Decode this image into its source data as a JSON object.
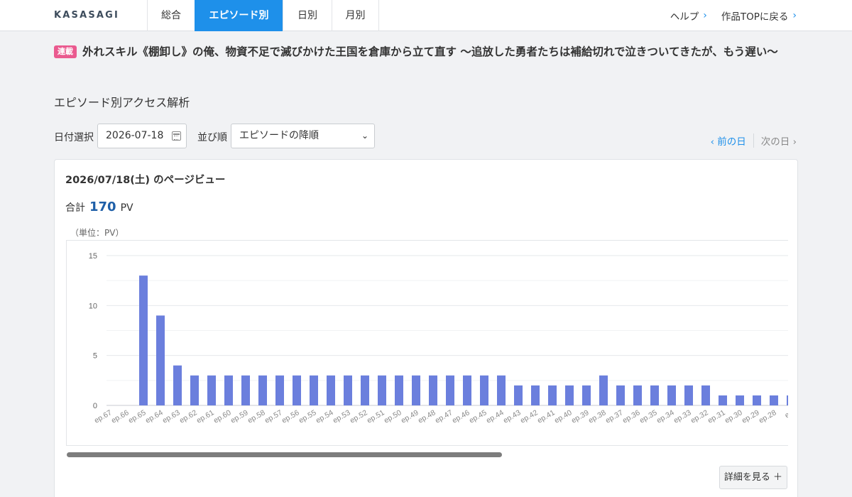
{
  "header": {
    "logo": "KASASAGI",
    "tabs": [
      {
        "label": "総合",
        "active": false
      },
      {
        "label": "エピソード別",
        "active": true
      },
      {
        "label": "日別",
        "active": false
      },
      {
        "label": "月別",
        "active": false
      }
    ],
    "help": "ヘルプ",
    "work_top": "作品TOPに戻る"
  },
  "work": {
    "badge": "連載",
    "title": "外れスキル《棚卸し》の俺、物資不足で滅びかけた王国を倉庫から立て直す 〜追放した勇者たちは補給切れで泣きついてきたが、もう遅い〜"
  },
  "section_title": "エピソード別アクセス解析",
  "filters": {
    "date_label": "日付選択",
    "date_value": "2026-07-18",
    "sort_label": "並び順",
    "sort_value": "エピソードの降順",
    "prev_day": "前の日",
    "next_day": "次の日"
  },
  "card": {
    "title": "2026/07/18(土) のページビュー",
    "total_label": "合計",
    "total_value": "170",
    "total_unit": "PV",
    "unit_note": "（単位：PV）",
    "detail_button": "詳細を見る ＋"
  },
  "colors": {
    "accent": "#1e90ea",
    "bar": "#6b7fdd",
    "badge": "#ea5a8f",
    "total": "#1e5fa8"
  },
  "chart_data": {
    "type": "bar",
    "ylim": [
      0,
      15
    ],
    "yticks": [
      0,
      5,
      10,
      15
    ],
    "grid": true,
    "categories": [
      "ep.67",
      "ep.66",
      "ep.65",
      "ep.64",
      "ep.63",
      "ep.62",
      "ep.61",
      "ep.60",
      "ep.59",
      "ep.58",
      "ep.57",
      "ep.56",
      "ep.55",
      "ep.54",
      "ep.53",
      "ep.52",
      "ep.51",
      "ep.50",
      "ep.49",
      "ep.48",
      "ep.47",
      "ep.46",
      "ep.45",
      "ep.44",
      "ep.43",
      "ep.42",
      "ep.41",
      "ep.40",
      "ep.39",
      "ep.38",
      "ep.37",
      "ep.36",
      "ep.35",
      "ep.34",
      "ep.33",
      "ep.32",
      "ep.31",
      "ep.30",
      "ep.29",
      "ep.28",
      "ep"
    ],
    "values": [
      0,
      0,
      13,
      9,
      4,
      3,
      3,
      3,
      3,
      3,
      3,
      3,
      3,
      3,
      3,
      3,
      3,
      3,
      3,
      3,
      3,
      3,
      3,
      3,
      2,
      2,
      2,
      2,
      2,
      3,
      2,
      2,
      2,
      2,
      2,
      2,
      1,
      1,
      1,
      1,
      1
    ]
  }
}
